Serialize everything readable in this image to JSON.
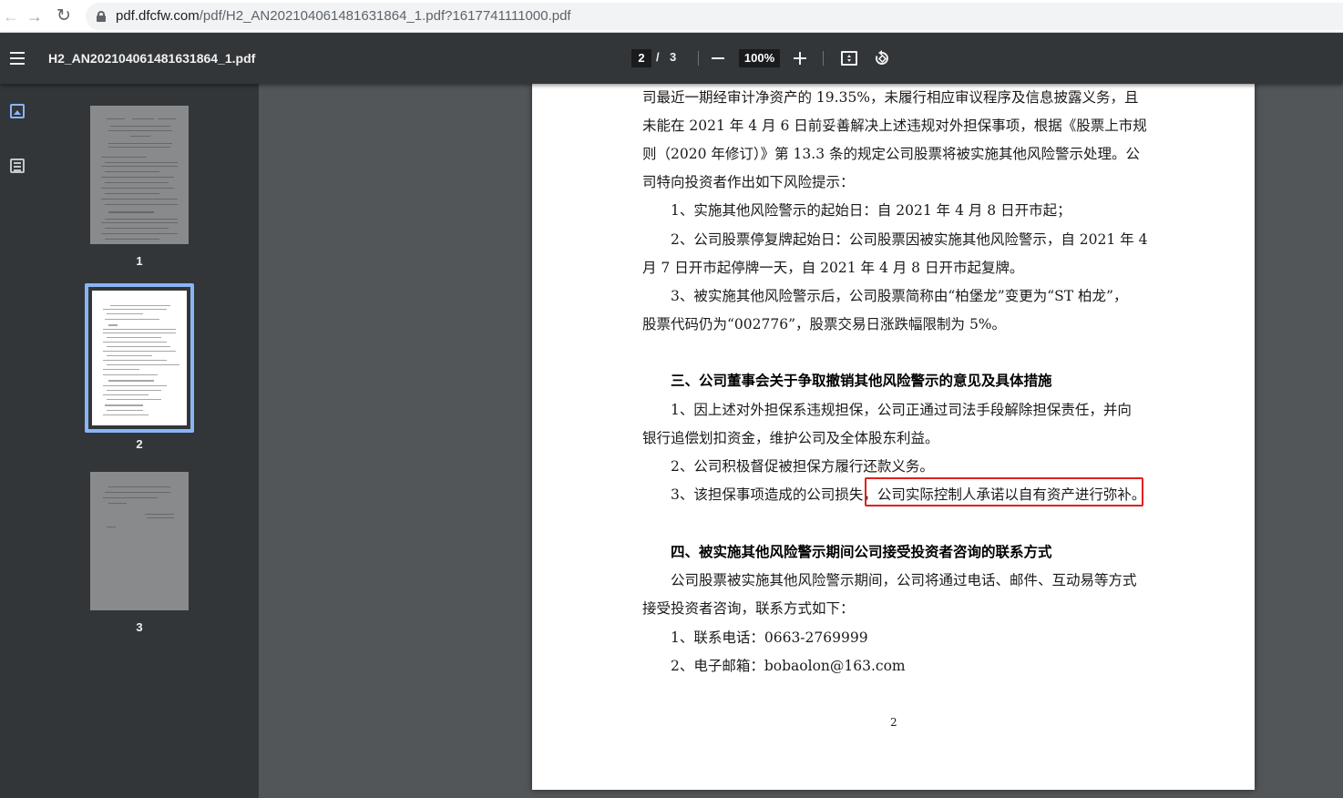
{
  "browser": {
    "url_host": "pdf.dfcfw.com",
    "url_path": "/pdf/H2_AN202104061481631864_1.pdf?1617741111000.pdf"
  },
  "toolbar": {
    "file_title": "H2_AN202104061481631864_1.pdf",
    "current_page": "2",
    "page_separator": "/",
    "total_pages": "3",
    "zoom": "100%"
  },
  "thumbnails": [
    {
      "label": "1",
      "active": false
    },
    {
      "label": "2",
      "active": true
    },
    {
      "label": "3",
      "active": false
    }
  ],
  "document": {
    "lines": [
      "司最近一期经审计净资产的 19.35%，未履行相应审议程序及信息披露义务，且",
      "未能在 2021 年 4 月 6 日前妥善解决上述违规对外担保事项，根据《股票上市规",
      "则（2020 年修订）》第 13.3 条的规定公司股票将被实施其他风险警示处理。公",
      "司特向投资者作出如下风险提示：",
      "1、实施其他风险警示的起始日：自 2021 年 4 月 8 日开市起；",
      "2、公司股票停复牌起始日：公司股票因被实施其他风险警示，自 2021 年 4",
      "月 7 日开市起停牌一天，自 2021 年 4 月 8 日开市起复牌。",
      "3、被实施其他风险警示后，公司股票简称由“柏堡龙”变更为“ST 柏龙”，",
      "股票代码仍为“002776”，股票交易日涨跌幅限制为 5%。"
    ],
    "heading3": "三、公司董事会关于争取撤销其他风险警示的意见及具体措施",
    "section3": [
      "1、因上述对外担保系违规担保，公司正通过司法手段解除担保责任，并向",
      "银行追偿划扣资金，维护公司及全体股东利益。",
      "2、公司积极督促被担保方履行还款义务。",
      "3、该担保事项造成的公司损失，公司实际控制人承诺以自有资产进行弥补。"
    ],
    "heading4": "四、被实施其他风险警示期间公司接受投资者咨询的联系方式",
    "section4": [
      "公司股票被实施其他风险警示期间，公司将通过电话、邮件、互动易等方式",
      "接受投资者咨询，联系方式如下：",
      "1、联系电话：0663-2769999",
      "2、电子邮箱：bobaolon@163.com"
    ],
    "page_number": "2"
  },
  "colors": {
    "toolbar_bg": "#323639",
    "viewer_bg": "#525659",
    "highlight_border": "#e02020",
    "active_thumb_border": "#8ab4f8"
  }
}
